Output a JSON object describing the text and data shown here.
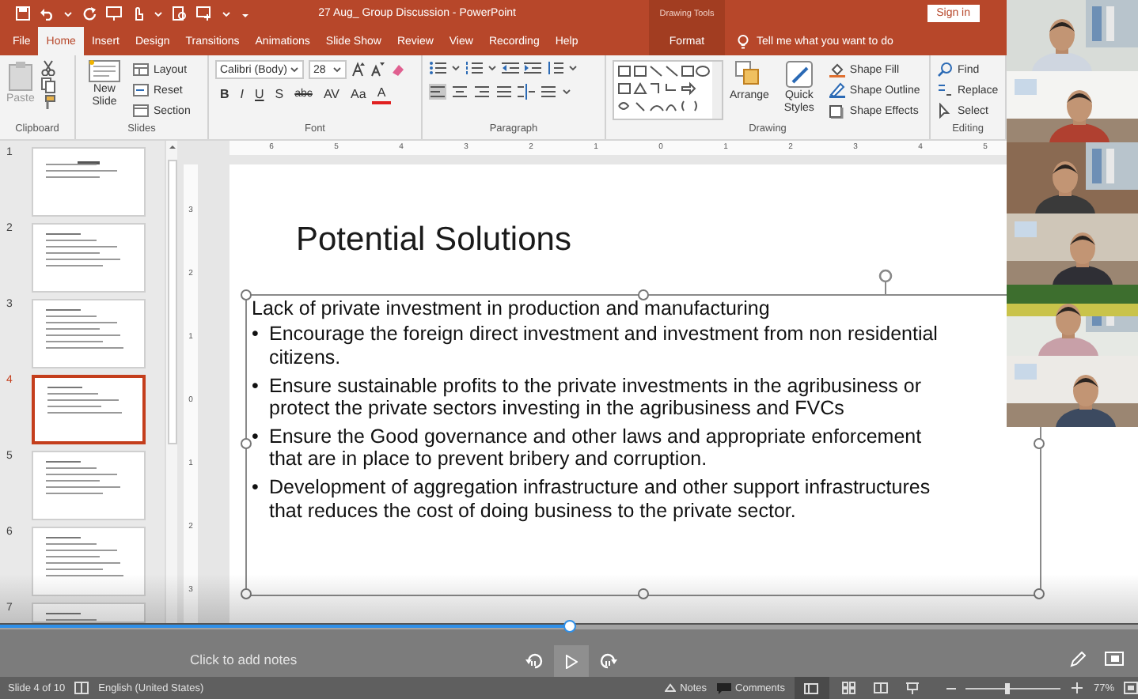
{
  "title_bar": {
    "title": "27 Aug_ Group Discussion  -  PowerPoint",
    "context_label": "Drawing Tools",
    "sign_in": "Sign in"
  },
  "tabs": [
    {
      "label": "File",
      "kind": "normal",
      "selected": false
    },
    {
      "label": "Home",
      "kind": "normal",
      "selected": true
    },
    {
      "label": "Insert",
      "kind": "normal",
      "selected": false
    },
    {
      "label": "Design",
      "kind": "normal",
      "selected": false
    },
    {
      "label": "Transitions",
      "kind": "normal",
      "selected": false
    },
    {
      "label": "Animations",
      "kind": "normal",
      "selected": false
    },
    {
      "label": "Slide Show",
      "kind": "normal",
      "selected": false
    },
    {
      "label": "Review",
      "kind": "normal",
      "selected": false
    },
    {
      "label": "View",
      "kind": "normal",
      "selected": false
    },
    {
      "label": "Recording",
      "kind": "normal",
      "selected": false
    },
    {
      "label": "Help",
      "kind": "normal",
      "selected": false
    },
    {
      "label": "Format",
      "kind": "contextual",
      "selected": false
    }
  ],
  "tell_me": "Tell me what you want to do",
  "ribbon": {
    "clipboard": {
      "label": "Clipboard",
      "paste": "Paste"
    },
    "slides": {
      "label": "Slides",
      "new_slide": "New Slide",
      "layout": "Layout",
      "reset": "Reset",
      "section": "Section"
    },
    "font": {
      "label": "Font",
      "font_name": "Calibri (Body)",
      "font_size": "28",
      "format_buttons": [
        "B",
        "I",
        "U",
        "S",
        "abc",
        "AV",
        "Aa",
        "A"
      ]
    },
    "paragraph": {
      "label": "Paragraph"
    },
    "drawing": {
      "label": "Drawing",
      "arrange": "Arrange",
      "quick_styles": "Quick Styles",
      "shape_fill": "Shape Fill",
      "shape_outline": "Shape Outline",
      "shape_effects": "Shape Effects"
    },
    "editing": {
      "label": "Editing",
      "find": "Find",
      "replace": "Replace",
      "select": "Select"
    }
  },
  "ruler": {
    "horizontal": [
      "6",
      "5",
      "4",
      "3",
      "2",
      "1",
      "0",
      "1",
      "2",
      "3",
      "4",
      "5"
    ],
    "vertical": [
      "3",
      "2",
      "1",
      "0",
      "1",
      "2",
      "3"
    ]
  },
  "slide_thumbnails": [
    {
      "number": "1",
      "selected": false
    },
    {
      "number": "2",
      "selected": false
    },
    {
      "number": "3",
      "selected": false
    },
    {
      "number": "4",
      "selected": true
    },
    {
      "number": "5",
      "selected": false
    },
    {
      "number": "6",
      "selected": false
    },
    {
      "number": "7",
      "selected": false
    }
  ],
  "slide": {
    "title": "Potential Solutions",
    "body_heading": "Lack of private investment in production and manufacturing",
    "bullets": [
      {
        "marker": "•",
        "text": "Encourage the foreign direct investment and investment from non residential citizens."
      },
      {
        "marker": "•",
        "text": "Ensure sustainable profits to the private investments in the agribusiness or protect the private sectors investing in the agribusiness and FVCs"
      },
      {
        "marker": "•",
        "text": "Ensure the Good governance and other laws and appropriate enforcement that are in place to prevent bribery and corruption."
      },
      {
        "marker": "•",
        "text": "Development of aggregation infrastructure and other support infrastructures that reduces the cost of doing business to the private sector."
      }
    ]
  },
  "notes": {
    "placeholder": "Click to add notes"
  },
  "status_bar": {
    "slide_position": "Slide 4 of 10",
    "language": "English (United States)",
    "notes": "Notes",
    "comments": "Comments",
    "zoom_slider": {
      "level": 0.45
    },
    "zoom": "77%"
  },
  "player": {
    "level": 0.5
  }
}
